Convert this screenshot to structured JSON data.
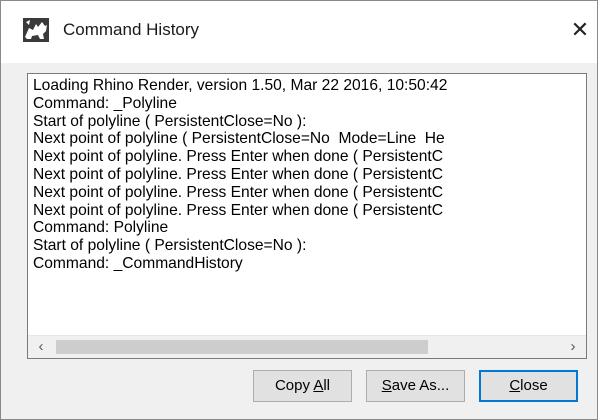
{
  "window": {
    "title": "Command History",
    "app_icon": "rhino-icon",
    "close_glyph": "✕"
  },
  "history": {
    "lines": [
      "Loading Rhino Render, version 1.50, Mar 22 2016, 10:50:42",
      "Command: _Polyline",
      "Start of polyline ( PersistentClose=No ):",
      "Next point of polyline ( PersistentClose=No  Mode=Line  He",
      "Next point of polyline. Press Enter when done ( PersistentC",
      "Next point of polyline. Press Enter when done ( PersistentC",
      "Next point of polyline. Press Enter when done ( PersistentC",
      "Next point of polyline. Press Enter when done ( PersistentC",
      "Command: Polyline",
      "Start of polyline ( PersistentClose=No ):",
      "Command: _CommandHistory"
    ]
  },
  "scrollbar": {
    "left_arrow": "‹",
    "right_arrow": "›"
  },
  "buttons": {
    "copy_all": {
      "label": "Copy All",
      "mnemonic": "A"
    },
    "save_as": {
      "label": "Save As...",
      "mnemonic": "S"
    },
    "close": {
      "label": "Close",
      "mnemonic": "C"
    }
  },
  "colors": {
    "focus_border": "#0078d7",
    "dialog_background": "#f0f0f0",
    "button_face": "#e1e1e1"
  }
}
